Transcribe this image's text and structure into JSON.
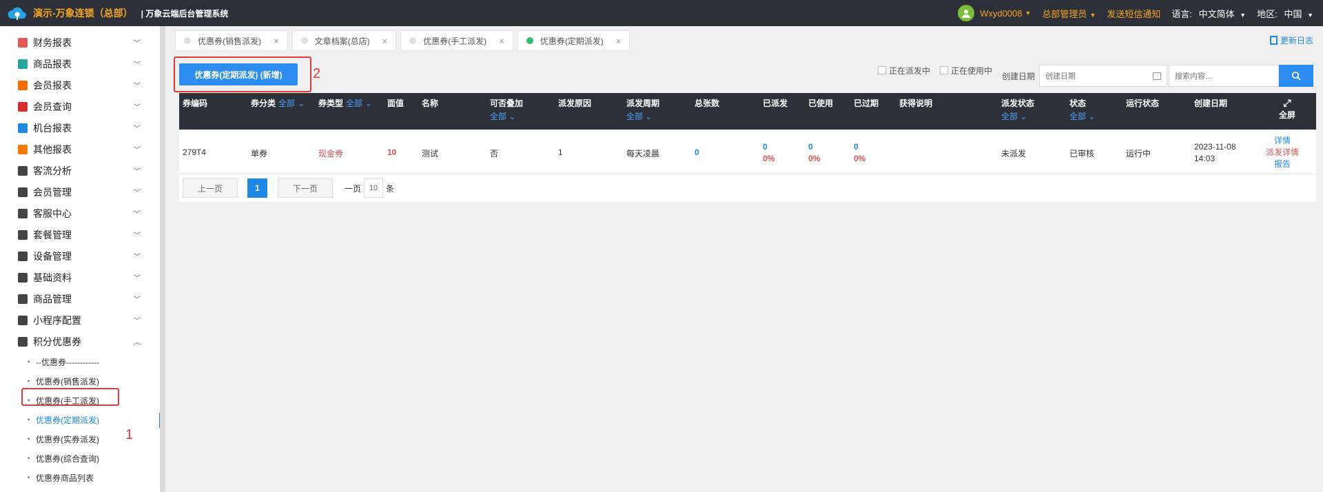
{
  "header": {
    "brand": "演示-万象连锁（总部）",
    "system_title": "| 万象云端后台管理系统",
    "username": "Wxyd0008",
    "role": "总部管理员",
    "sms_link": "发送短信通知",
    "language_label": "语言:",
    "language_value": "中文简体",
    "region_label": "地区:",
    "region_value": "中国"
  },
  "sidebar": {
    "items": [
      {
        "label": "财务报表",
        "color": "#e05a5a"
      },
      {
        "label": "商品报表",
        "color": "#26a69a"
      },
      {
        "label": "会员报表",
        "color": "#ef6c00"
      },
      {
        "label": "会员查询",
        "color": "#d32f2f"
      },
      {
        "label": "机台报表",
        "color": "#1e88e5"
      },
      {
        "label": "其他报表",
        "color": "#f57c00"
      },
      {
        "label": "客流分析",
        "color": "#444444"
      },
      {
        "label": "会员管理",
        "color": "#444444"
      },
      {
        "label": "客服中心",
        "color": "#444444"
      },
      {
        "label": "套餐管理",
        "color": "#444444"
      },
      {
        "label": "设备管理",
        "color": "#444444"
      },
      {
        "label": "基础资料",
        "color": "#444444"
      },
      {
        "label": "商品管理",
        "color": "#444444"
      },
      {
        "label": "小程序配置",
        "color": "#444444"
      },
      {
        "label": "积分优惠券",
        "color": "#444444"
      }
    ],
    "sub_items": [
      "--优惠券------------",
      "优惠券(销售派发)",
      "优惠券(手工派发)",
      "优惠券(定期派发)",
      "优惠券(实券派发)",
      "优惠券(综合查询)",
      "优惠券商品列表"
    ],
    "annotation": "1"
  },
  "tabs": [
    "优惠券(销售派发)",
    "文章档案(总店)",
    "优惠券(手工派发)",
    "优惠券(定期派发)"
  ],
  "update_log": "更新日志",
  "toolbar": {
    "add_button": "优惠券(定期派发) (新增)",
    "annotation": "2",
    "check_dispatching": "正在派发中",
    "check_in_use": "正在使用中",
    "date_label": "创建日期",
    "date_placeholder": "创建日期",
    "search_placeholder": "搜索内容..."
  },
  "table": {
    "headers": {
      "code": "券编码",
      "category": "券分类",
      "type": "券类型",
      "face": "面值",
      "name": "名称",
      "stackable": "可否叠加",
      "reason": "派发原因",
      "period": "派发周期",
      "total": "总张数",
      "dispatched": "已派发",
      "used": "已使用",
      "expired": "已过期",
      "acquire": "获得说明",
      "dispatch_status": "派发状态",
      "status": "状态",
      "run_status": "运行状态",
      "created": "创建日期",
      "fullscreen": "全屏",
      "all": "全部"
    },
    "row": {
      "code": "279T4",
      "category": "单券",
      "type": "现金券",
      "face": "10",
      "name": "测试",
      "stackable": "否",
      "reason": "1",
      "period": "每天凌晨",
      "total": "0",
      "dispatched": "0",
      "dispatched_pct": "0%",
      "used": "0",
      "used_pct": "0%",
      "expired": "0",
      "expired_pct": "0%",
      "dispatch_status": "未派发",
      "status": "已审核",
      "run_status": "运行中",
      "created_date": "2023-11-08",
      "created_time": "14:03",
      "action_detail": "详情",
      "action_dispatch": "派发详情",
      "action_report": "报告"
    }
  },
  "pager": {
    "prev": "上一页",
    "current": "1",
    "next": "下一页",
    "per_page_label": "一页",
    "per_page": "10",
    "unit": "条"
  }
}
